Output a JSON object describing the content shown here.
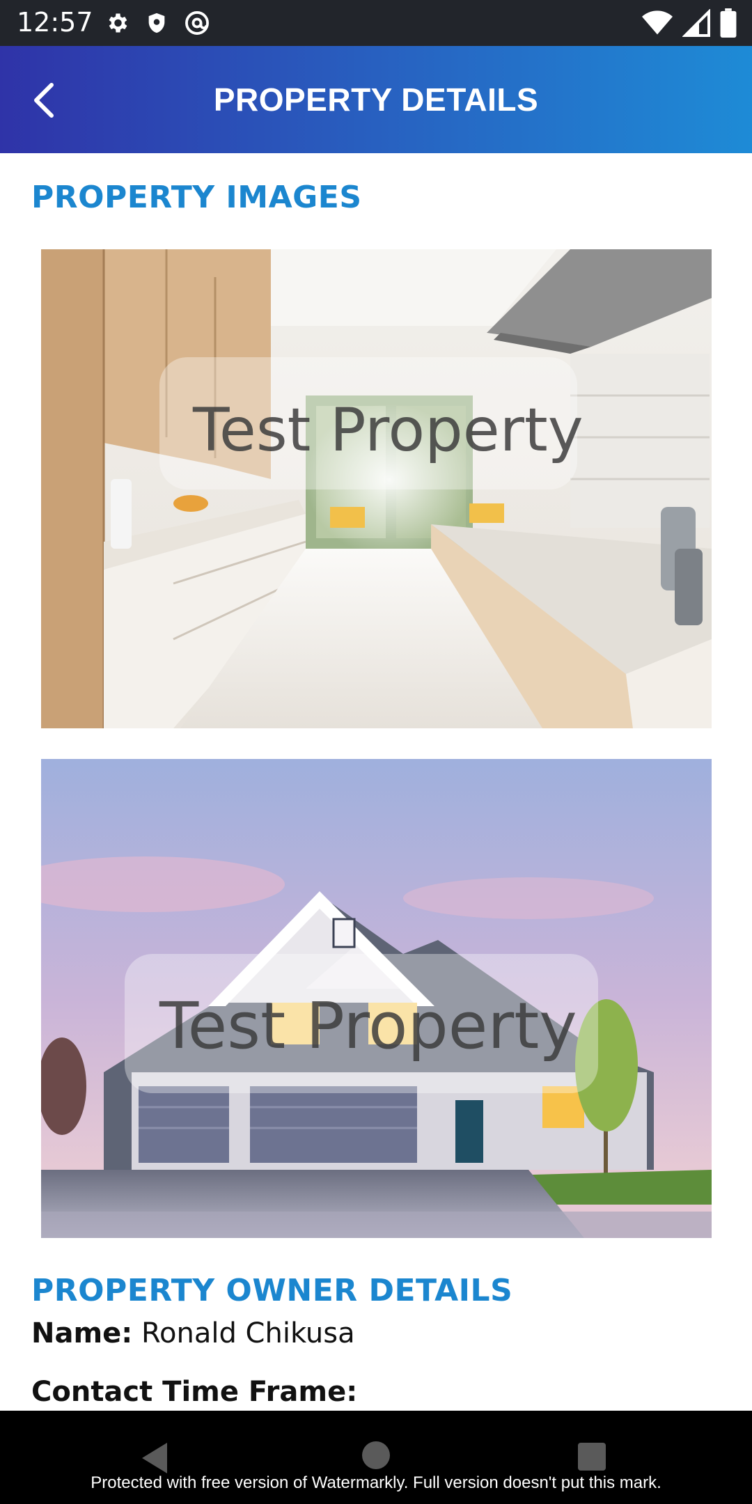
{
  "status_bar": {
    "time": "12:57",
    "left_icons": [
      "gear-icon",
      "shield-icon",
      "at-sign-icon"
    ],
    "right_icons": [
      "wifi-icon",
      "signal-icon",
      "battery-icon"
    ]
  },
  "app_bar": {
    "title": "PROPERTY DETAILS",
    "gradient": [
      "#2f33a8",
      "#1e8bd6"
    ]
  },
  "sections": {
    "images_title": "PROPERTY IMAGES",
    "owner_title": "PROPERTY OWNER DETAILS"
  },
  "images": [
    {
      "subject": "modern kitchen interior",
      "watermark": "Test Property"
    },
    {
      "subject": "suburban house exterior at dusk",
      "watermark": "Test Property"
    }
  ],
  "owner": {
    "name_label": "Name:",
    "name_value": "Ronald Chikusa",
    "contact_label": "Contact Time Frame:",
    "contact_value": ""
  },
  "nav_bar": {
    "watermark": "Protected with free version of Watermarkly. Full version doesn't put this mark."
  },
  "colors": {
    "accent": "#1b86cf",
    "status_bar": "#22252b"
  }
}
